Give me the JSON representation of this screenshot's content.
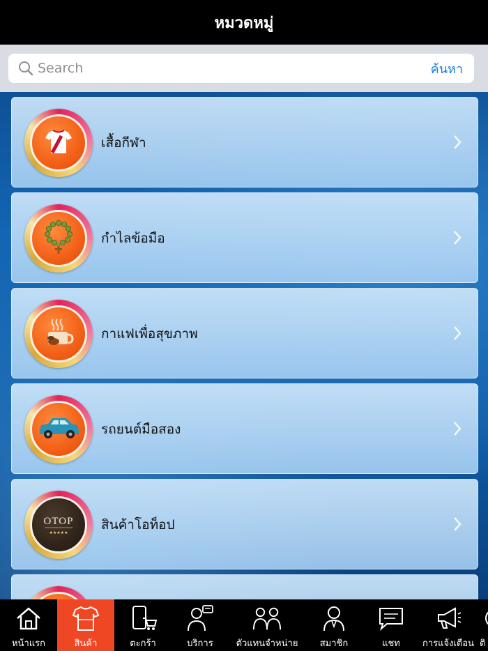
{
  "header": {
    "title": "หมวดหมู่"
  },
  "search": {
    "placeholder": "Search",
    "button_label": "ค้นหา"
  },
  "categories": [
    {
      "label": "เสื้อกีฬา",
      "icon": "jersey-icon"
    },
    {
      "label": "กำไลข้อมือ",
      "icon": "bracelet-icon"
    },
    {
      "label": "กาแฟเพื่อสุขภาพ",
      "icon": "coffee-icon"
    },
    {
      "label": "รถยนต์มือสอง",
      "icon": "car-icon"
    },
    {
      "label": "สินค้าโอท็อป",
      "icon": "otop-logo",
      "logo_text": "OTOP"
    },
    {
      "label": "",
      "icon": "category-icon"
    }
  ],
  "tabbar": {
    "items": [
      {
        "label": "หน้าแรก",
        "icon": "home-icon",
        "active": false
      },
      {
        "label": "สินค้า",
        "icon": "shirt-icon",
        "active": true
      },
      {
        "label": "ตะกร้า",
        "icon": "cart-icon",
        "active": false
      },
      {
        "label": "บริการ",
        "icon": "service-icon",
        "active": false
      },
      {
        "label": "ตัวแทนจำหน่าย",
        "icon": "dealers-icon",
        "active": false
      },
      {
        "label": "สมาชิก",
        "icon": "member-icon",
        "active": false
      },
      {
        "label": "แชท",
        "icon": "chat-icon",
        "active": false
      },
      {
        "label": "การแจ้งเตือน",
        "icon": "megaphone-icon",
        "active": false
      },
      {
        "label": "ติ",
        "icon": "contact-icon",
        "active": false
      }
    ],
    "active_color": "#ef4723"
  }
}
